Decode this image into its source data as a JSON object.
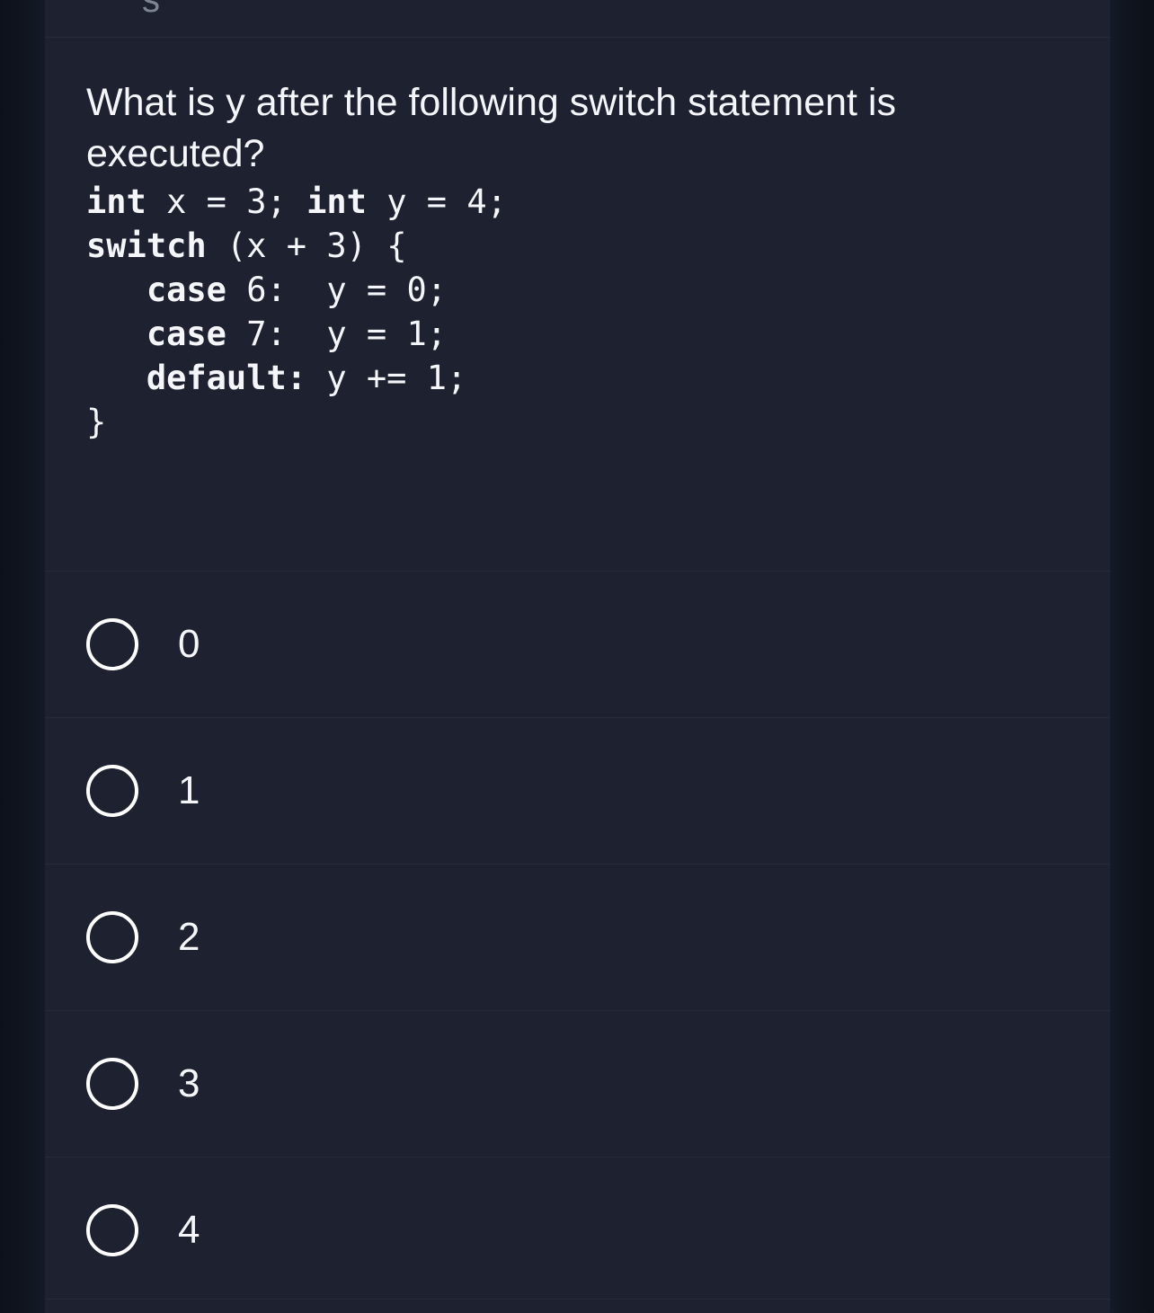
{
  "colors": {
    "card_background": "#1e2230",
    "page_background": "#10151f",
    "divider": "#262b3a",
    "text": "#f4f6fa",
    "radio_border": "#ffffff"
  },
  "question": {
    "prompt": "What is y after the following switch statement is executed?",
    "code_lines": [
      {
        "keyword": "int",
        "rest": " x = 3; ",
        "keyword2": "int",
        "rest2": " y = 4;"
      },
      {
        "keyword": "switch",
        "rest": " (x + 3) {",
        "keyword2": "",
        "rest2": ""
      },
      {
        "keyword": "   case",
        "rest": " 6:  y = 0;",
        "keyword2": "",
        "rest2": ""
      },
      {
        "keyword": "   case",
        "rest": " 7:  y = 1;",
        "keyword2": "",
        "rest2": ""
      },
      {
        "keyword": "   default:",
        "rest": " y += 1;",
        "keyword2": "",
        "rest2": ""
      },
      {
        "keyword": "",
        "rest": "}",
        "keyword2": "",
        "rest2": ""
      }
    ],
    "code_text": "int x = 3; int y = 4;\nswitch (x + 3) {\n   case 6:  y = 0;\n   case 7:  y = 1;\n   default: y += 1;\n}"
  },
  "options": [
    {
      "label": "0",
      "selected": false
    },
    {
      "label": "1",
      "selected": false
    },
    {
      "label": "2",
      "selected": false
    },
    {
      "label": "3",
      "selected": false
    },
    {
      "label": "4",
      "selected": false
    }
  ],
  "scroll_remnant": {
    "glyph": "s"
  }
}
